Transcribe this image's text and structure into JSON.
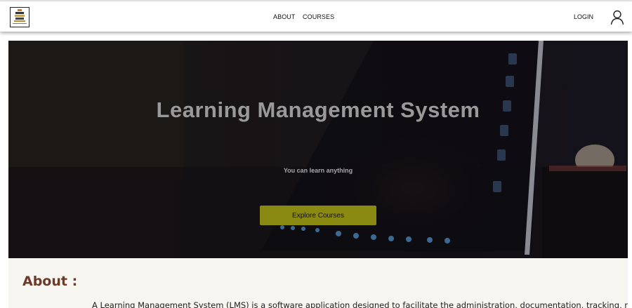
{
  "nav": {
    "about": "ABOUT",
    "courses": "COURSES",
    "login": "LOGIN"
  },
  "hero": {
    "title": "Learning Management System",
    "subtitle": "You can learn anything",
    "button": "Explore Courses"
  },
  "about": {
    "heading": "About :",
    "text": "A Learning Management System (LMS) is a software application designed to facilitate the administration, documentation, tracking, reporting, and"
  },
  "colors": {
    "button_bg": "#8a8a12",
    "heading": "#6b3a2a",
    "about_bg": "#f6f5f0"
  },
  "icons": [
    "logo",
    "user-icon"
  ]
}
